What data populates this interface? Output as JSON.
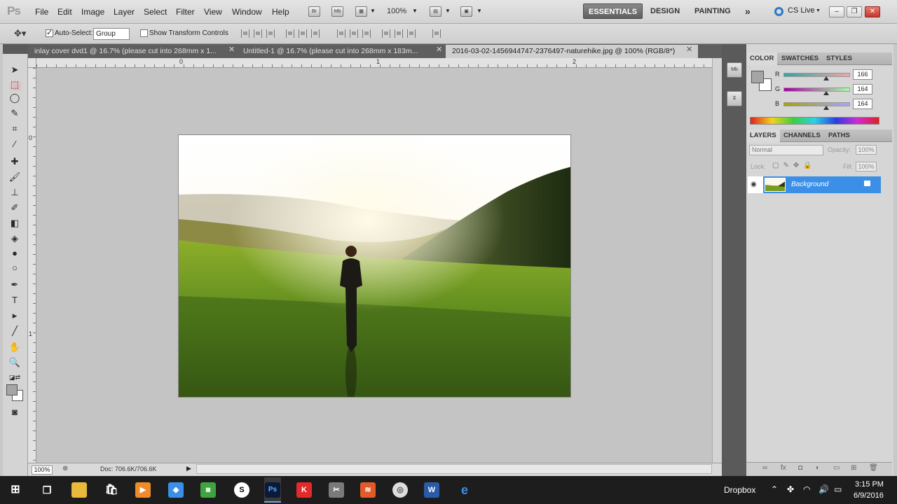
{
  "app": {
    "logo": "Ps",
    "menu": [
      "File",
      "Edit",
      "Image",
      "Layer",
      "Select",
      "Filter",
      "View",
      "Window",
      "Help"
    ],
    "menubar_icons": [
      "Br",
      "Mb"
    ],
    "zoom": "100%",
    "workspaces": [
      "ESSENTIALS",
      "DESIGN",
      "PAINTING"
    ],
    "workspace_more": "»",
    "cs_live": "CS Live",
    "window_controls": {
      "minimize": "–",
      "restore": "❐",
      "close": "✕"
    }
  },
  "options": {
    "auto_select_label": "Auto-Select:",
    "auto_select_checked": true,
    "auto_select_value": "Group",
    "show_transform_label": "Show Transform Controls",
    "show_transform_checked": false
  },
  "tabs": [
    {
      "label": "inlay cover dvd1 @ 16.7% (please cut into 268mm x 1...",
      "active": false
    },
    {
      "label": "Untitled-1 @ 16.7% (please cut into 268mm x 183m...",
      "active": false
    },
    {
      "label": "2016-03-02-1456944747-2376497-naturehike.jpg @ 100% (RGB/8*)",
      "active": true
    }
  ],
  "tab_close": "✕",
  "ruler": {
    "top_labels": [
      "0",
      "1",
      "2"
    ],
    "left_labels": [
      "0",
      "1"
    ]
  },
  "status": {
    "zoom": "100%",
    "doc": "Doc: 706.6K/706.6K",
    "arrow": "▶"
  },
  "dock": [
    "Mb"
  ],
  "color_panel": {
    "tabs": [
      "COLOR",
      "SWATCHES",
      "STYLES"
    ],
    "channels": [
      {
        "label": "R",
        "value": "166",
        "color": "#cc3b3b"
      },
      {
        "label": "G",
        "value": "164",
        "color": "#3fb03f"
      },
      {
        "label": "B",
        "value": "164",
        "color": "#3b53cc"
      }
    ]
  },
  "layers_panel": {
    "tabs": [
      "LAYERS",
      "CHANNELS",
      "PATHS"
    ],
    "blend_mode": "Normal",
    "opacity_label": "Opacity:",
    "opacity": "100%",
    "lock_label": "Lock:",
    "fill_label": "Fill:",
    "fill": "100%",
    "layers": [
      {
        "name": "Background",
        "visible": true,
        "locked": true
      }
    ]
  },
  "taskbar": {
    "dropbox_label": "Dropbox",
    "time": "3:15 PM",
    "date": "6/9/2016",
    "ps_label": "Ps",
    "word_label": "W"
  }
}
